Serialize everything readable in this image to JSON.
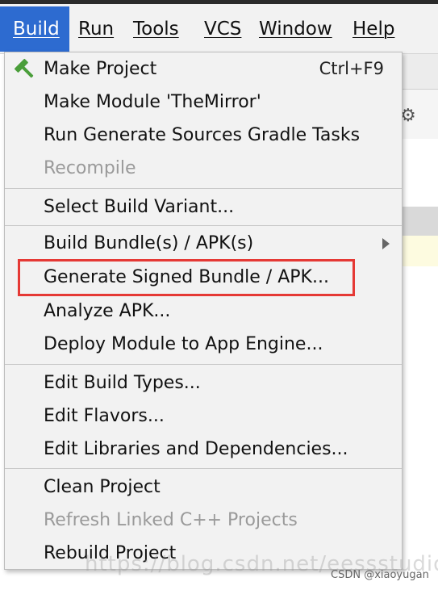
{
  "menubar": {
    "items": [
      {
        "label": "Build",
        "active": true
      },
      {
        "label": "Run"
      },
      {
        "label": "Tools"
      },
      {
        "label": "VCS"
      },
      {
        "label": "Window"
      },
      {
        "label": "Help"
      }
    ]
  },
  "build_menu": {
    "items": [
      {
        "label": "Make Project",
        "shortcut": "Ctrl+F9",
        "icon": "hammer-icon"
      },
      {
        "label": "Make Module 'TheMirror'"
      },
      {
        "label": "Run Generate Sources Gradle Tasks"
      },
      {
        "label": "Recompile",
        "disabled": true
      },
      {
        "label": "Select Build Variant..."
      },
      {
        "label": "Build Bundle(s) / APK(s)",
        "submenu": true
      },
      {
        "label": "Generate Signed Bundle / APK...",
        "highlighted": true
      },
      {
        "label": "Analyze APK..."
      },
      {
        "label": "Deploy Module to App Engine..."
      },
      {
        "label": "Edit Build Types..."
      },
      {
        "label": "Edit Flavors..."
      },
      {
        "label": "Edit Libraries and Dependencies..."
      },
      {
        "label": "Clean Project"
      },
      {
        "label": "Refresh Linked C++ Projects",
        "disabled": true
      },
      {
        "label": "Rebuild Project"
      }
    ]
  },
  "colors": {
    "active_menu": "#2d6bd0",
    "highlight_border": "#e53935",
    "hammer": "#4a9e3a"
  },
  "watermark": {
    "text": "https://blog.csdn.net/eessstudio",
    "credit": "CSDN @xiaoyugan"
  }
}
